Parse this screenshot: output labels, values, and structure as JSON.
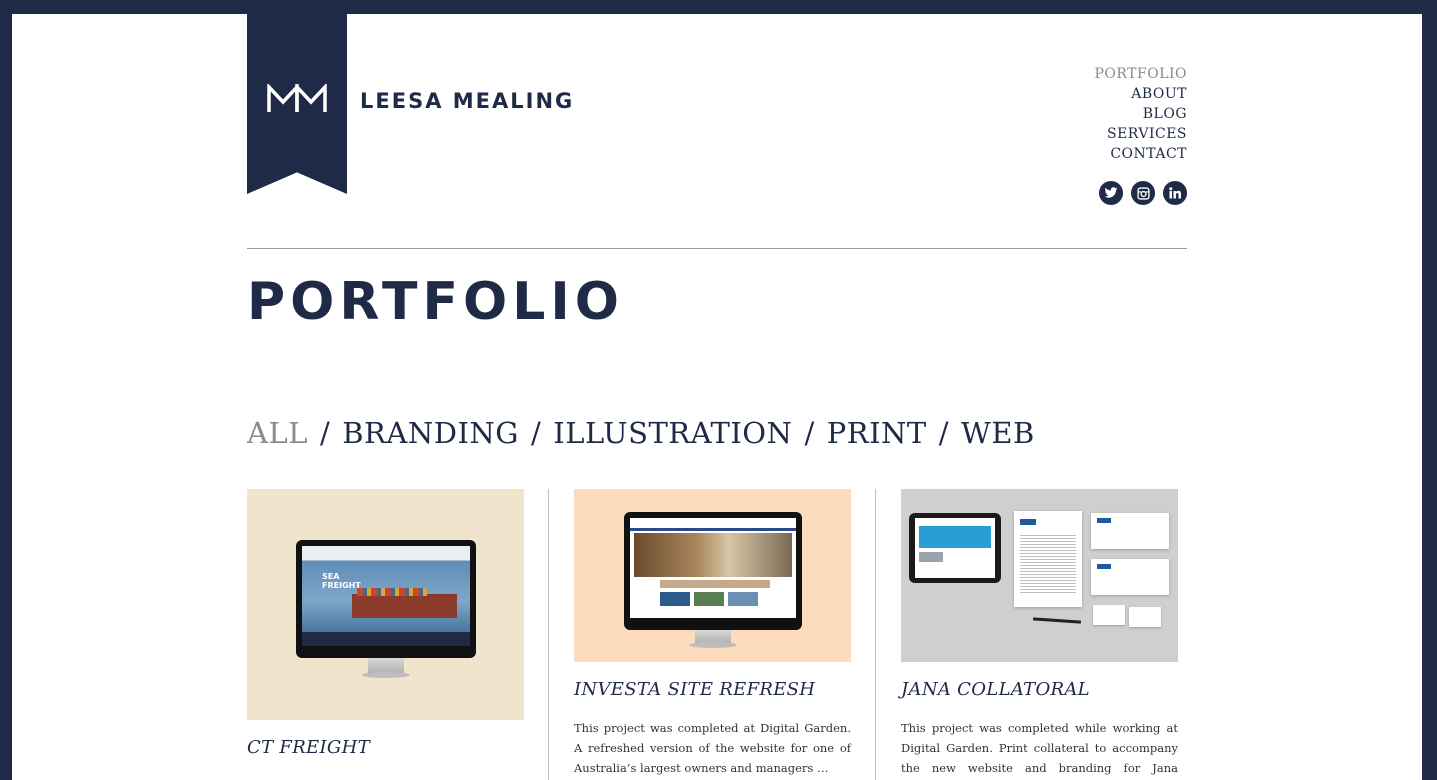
{
  "brand": {
    "logo_text": "MM",
    "name": "LEESA MEALING"
  },
  "nav": {
    "items": [
      {
        "label": "PORTFOLIO",
        "active": true
      },
      {
        "label": "ABOUT",
        "active": false
      },
      {
        "label": "BLOG",
        "active": false
      },
      {
        "label": "SERVICES",
        "active": false
      },
      {
        "label": "CONTACT",
        "active": false
      }
    ]
  },
  "social": [
    "twitter-icon",
    "instagram-icon",
    "linkedin-icon"
  ],
  "page": {
    "title": "PORTFOLIO"
  },
  "filters": {
    "items": [
      "ALL",
      "BRANDING",
      "ILLUSTRATION",
      "PRINT",
      "WEB"
    ],
    "active": "ALL",
    "separator": "/"
  },
  "portfolio": [
    {
      "title": "CT FREIGHT",
      "description": "",
      "screen_text": "SEA FREIGHT"
    },
    {
      "title": "INVESTA SITE REFRESH",
      "description": "This project was completed at Digital Garden. A refreshed version of the  website for one of Australia’s largest owners and managers …"
    },
    {
      "title": "JANA COLLATORAL",
      "description": "This project was completed while working at Digital Garden. Print collateral to accompany the new website and branding for Jana Investment Advisors."
    }
  ],
  "colors": {
    "navy": "#1f2a47",
    "muted": "#8a8a8a",
    "thumb1_bg": "#f0e4cc",
    "thumb2_bg": "#fddcbd",
    "thumb3_bg": "#cfcfcf"
  }
}
